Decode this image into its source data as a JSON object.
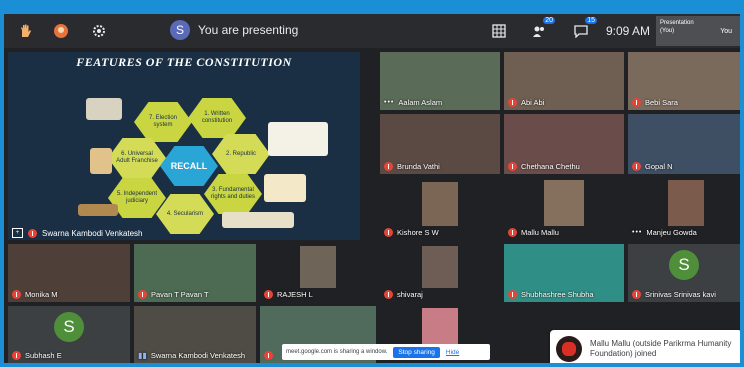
{
  "topbar": {
    "presenter_initial": "S",
    "presenting_text": "You are presenting",
    "people_count": "20",
    "chat_count": "15",
    "time": "9:09 AM",
    "self_line1": "Presentation",
    "self_line2": "(You)",
    "self_line3": "You",
    "icons": [
      "raise-hand-icon",
      "effects-icon",
      "settings-icon",
      "grid-layout-icon",
      "people-icon",
      "chat-icon"
    ]
  },
  "presentation": {
    "slide_title": "FEATURES OF THE CONSTITUTION",
    "center_label": "RECALL",
    "hexagons": [
      "1. Written constitution",
      "2. Republic",
      "3. Fundamental rights and duties",
      "4. Secularism",
      "5. Independent judiciary",
      "6. Universal Adult Franchise",
      "7. Election system"
    ],
    "presenter_name": "Swarna Kambodi Venkatesh"
  },
  "participants": [
    {
      "name": "Aalam Aslam",
      "muted": false
    },
    {
      "name": "Abi Abi",
      "muted": true
    },
    {
      "name": "Bebi Sara",
      "muted": true
    },
    {
      "name": "Brunda Vathi",
      "muted": true
    },
    {
      "name": "Chethana Chethu",
      "muted": true
    },
    {
      "name": "Gopal N",
      "muted": true
    },
    {
      "name": "Kishore S W",
      "muted": true
    },
    {
      "name": "Mallu Mallu",
      "muted": true
    },
    {
      "name": "Manjeu Gowda",
      "muted": false
    },
    {
      "name": "Monika M",
      "muted": true
    },
    {
      "name": "Pavan T Pavan T",
      "muted": true
    },
    {
      "name": "RAJESH L",
      "muted": true
    },
    {
      "name": "shivaraj",
      "muted": true
    },
    {
      "name": "Shubhashree Shubha",
      "muted": true
    },
    {
      "name": "Srinivas Srinivas kavi",
      "muted": true,
      "avatar": "S"
    },
    {
      "name": "Subhash E",
      "muted": true,
      "avatar": "S"
    },
    {
      "name": "Swarna Kambodi Venkatesh",
      "muted": false
    },
    {
      "name": "",
      "muted": true
    },
    {
      "name": "",
      "muted": true
    }
  ],
  "sharing_toast": {
    "text": "meet.google.com is sharing a window.",
    "stop_label": "Stop sharing",
    "hide_label": "Hide"
  },
  "notification": {
    "text": "Mallu Mallu (outside Parikrma Humanity Foundation) joined"
  },
  "colors": {
    "frame": "#1a8fd6",
    "meet_bg": "#202124",
    "mic_off": "#ea4335",
    "hex": "#c9d641",
    "recall": "#2aa6d6"
  }
}
